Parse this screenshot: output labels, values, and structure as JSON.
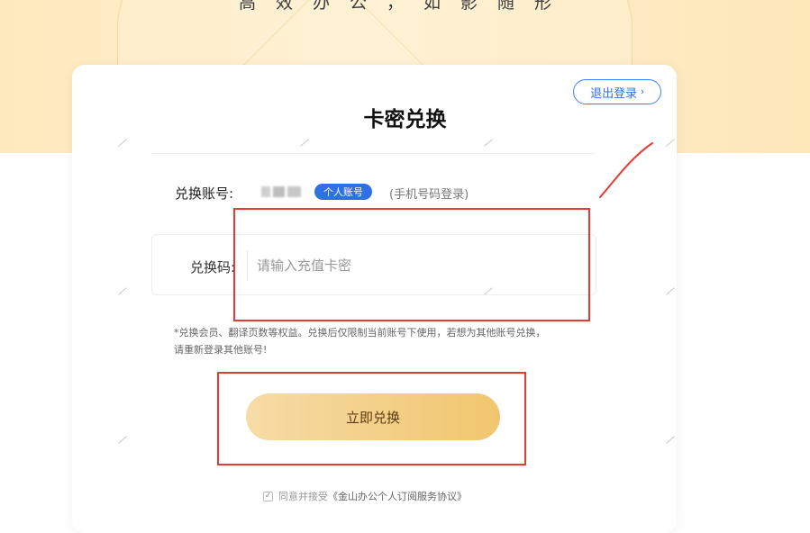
{
  "header": {
    "slogan": "高效办公，如影随形"
  },
  "card": {
    "title": "卡密兑换",
    "logout_label": "退出登录",
    "logout_chevron": "›",
    "account": {
      "label": "兑换账号:",
      "badge": "个人账号",
      "hint": "(手机号码登录)"
    },
    "code": {
      "label": "兑换码:",
      "placeholder": "请输入充值卡密",
      "value": ""
    },
    "notice_line1": "*兑换会员、翻译页数等权益。兑换后仅限制当前账号下使用，若想为其他账号兑换，",
    "notice_line2": "请重新登录其他账号!",
    "redeem_label": "立即兑换",
    "agreement": {
      "checked": true,
      "check_glyph": "✓",
      "prefix": "同意并接受",
      "link": "《金山办公个人订阅服务协议》"
    }
  },
  "annotation_color": "#e43b33",
  "accent_color": "#2f6fe8"
}
